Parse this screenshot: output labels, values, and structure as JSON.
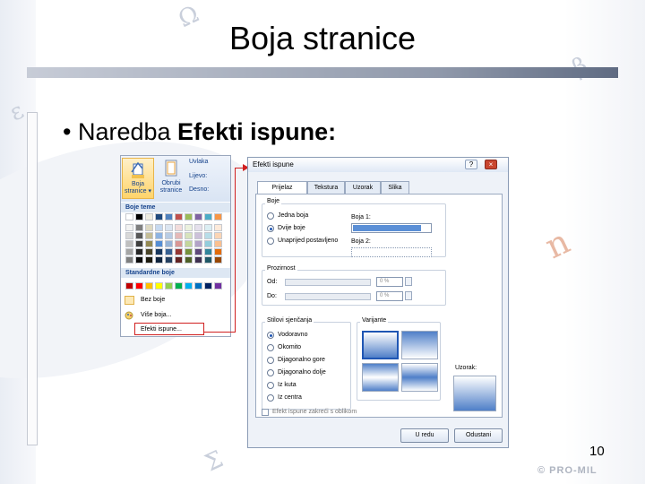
{
  "slide": {
    "title": "Boja stranice",
    "bullet_prefix": "Naredba ",
    "bullet_bold": "Efekti ispune:",
    "page_number": "10",
    "footer_logo": "© PRO-MIL"
  },
  "gallery": {
    "ribbon": {
      "btn1_line1": "Boja",
      "btn1_line2": "stranice ▾",
      "btn2_line1": "Obrubi",
      "btn2_line2": "stranice",
      "side_title": "Uvlaka",
      "side_left": "Lijevo:",
      "side_right": "Desno:"
    },
    "theme_colors_label": "Boje teme",
    "standard_colors_label": "Standardne boje",
    "theme_top_row": [
      "#ffffff",
      "#000000",
      "#eeece1",
      "#1f497d",
      "#4f81bd",
      "#c0504d",
      "#9bbb59",
      "#8064a2",
      "#4bacc6",
      "#f79646"
    ],
    "theme_shades": [
      [
        "#f2f2f2",
        "#7f7f7f",
        "#ddd9c3",
        "#c6d9f0",
        "#dbe5f1",
        "#f2dcdb",
        "#ebf1dd",
        "#e5e0ec",
        "#dbeef3",
        "#fdeada"
      ],
      [
        "#d8d8d8",
        "#595959",
        "#c4bd97",
        "#8db3e2",
        "#b8cce4",
        "#e5b9b7",
        "#d7e3bc",
        "#ccc1d9",
        "#b7dde8",
        "#fbd5b5"
      ],
      [
        "#bfbfbf",
        "#3f3f3f",
        "#938953",
        "#548dd4",
        "#95b3d7",
        "#d99694",
        "#c3d69b",
        "#b2a2c7",
        "#92cddc",
        "#fac08f"
      ],
      [
        "#a5a5a5",
        "#262626",
        "#494429",
        "#17365d",
        "#366092",
        "#953734",
        "#76923c",
        "#5f497a",
        "#31859b",
        "#e36c09"
      ],
      [
        "#7f7f7f",
        "#0c0c0c",
        "#1d1b10",
        "#0f243e",
        "#244061",
        "#632423",
        "#4f6128",
        "#3f3151",
        "#205867",
        "#974806"
      ]
    ],
    "standard_row": [
      "#c00000",
      "#ff0000",
      "#ffc000",
      "#ffff00",
      "#92d050",
      "#00b050",
      "#00b0f0",
      "#0070c0",
      "#002060",
      "#7030a0"
    ],
    "no_color": "Bez boje",
    "more_colors": "Više boja...",
    "fill_effects": "Efekti ispune..."
  },
  "dialog": {
    "title": "Efekti ispune",
    "help": "?",
    "close": "×",
    "tabs": [
      "Prijelaz",
      "Tekstura",
      "Uzorak",
      "Slika"
    ],
    "colors_label": "Boje",
    "color_options": [
      "Jedna boja",
      "Dvije boje",
      "Unaprijed postavljeno"
    ],
    "color1_label": "Boja 1:",
    "color2_label": "Boja 2:",
    "color1_value": "#5b8fd6",
    "transparency_label": "Prozirnost",
    "from_label": "Od:",
    "to_label": "Do:",
    "from_value": "0 %",
    "to_value": "0 %",
    "shading_label": "Stilovi sjenčanja",
    "shading_options": [
      "Vodoravno",
      "Okomito",
      "Dijagonalno gore",
      "Dijagonalno dolje",
      "Iz kuta",
      "Iz centra"
    ],
    "variants_label": "Varijante",
    "sample_label": "Uzorak:",
    "rotate_label": "Efekt ispune zakreći s oblikom",
    "ok_label": "U redu",
    "cancel_label": "Odustani"
  }
}
